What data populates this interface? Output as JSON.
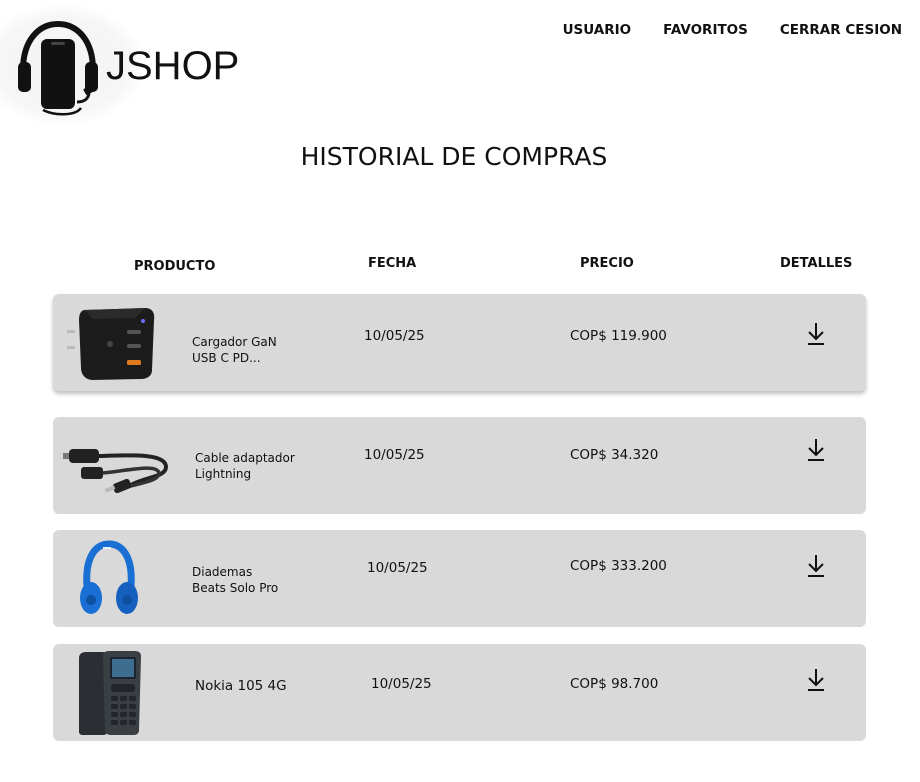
{
  "brand": {
    "name": "JSHOP"
  },
  "nav": {
    "user": "USUARIO",
    "favorites": "FAVORITOS",
    "logout": "CERRAR CESION"
  },
  "page": {
    "title": "HISTORIAL DE COMPRAS"
  },
  "columns": {
    "product": "PRODUCTO",
    "date": "FECHA",
    "price": "PRECIO",
    "details": "DETALLES"
  },
  "purchases": [
    {
      "name": "Cargador GaN\nUSB C PD...",
      "date": "10/05/25",
      "price": "COP$ 119.900",
      "icon": "download-icon",
      "image": "charger"
    },
    {
      "name": "Cable adaptador\nLightning",
      "date": "10/05/25",
      "price": "COP$ 34.320",
      "icon": "download-icon",
      "image": "cable-adapter"
    },
    {
      "name": "Diademas\nBeats Solo Pro",
      "date": "10/05/25",
      "price": "COP$ 333.200",
      "icon": "download-icon",
      "image": "headphones"
    },
    {
      "name": "Nokia 105 4G",
      "date": "10/05/25",
      "price": "COP$ 98.700",
      "icon": "download-icon",
      "image": "phone"
    }
  ],
  "colors": {
    "row_bg": "#d9d9d9",
    "headphone_blue": "#1a6fd4"
  }
}
